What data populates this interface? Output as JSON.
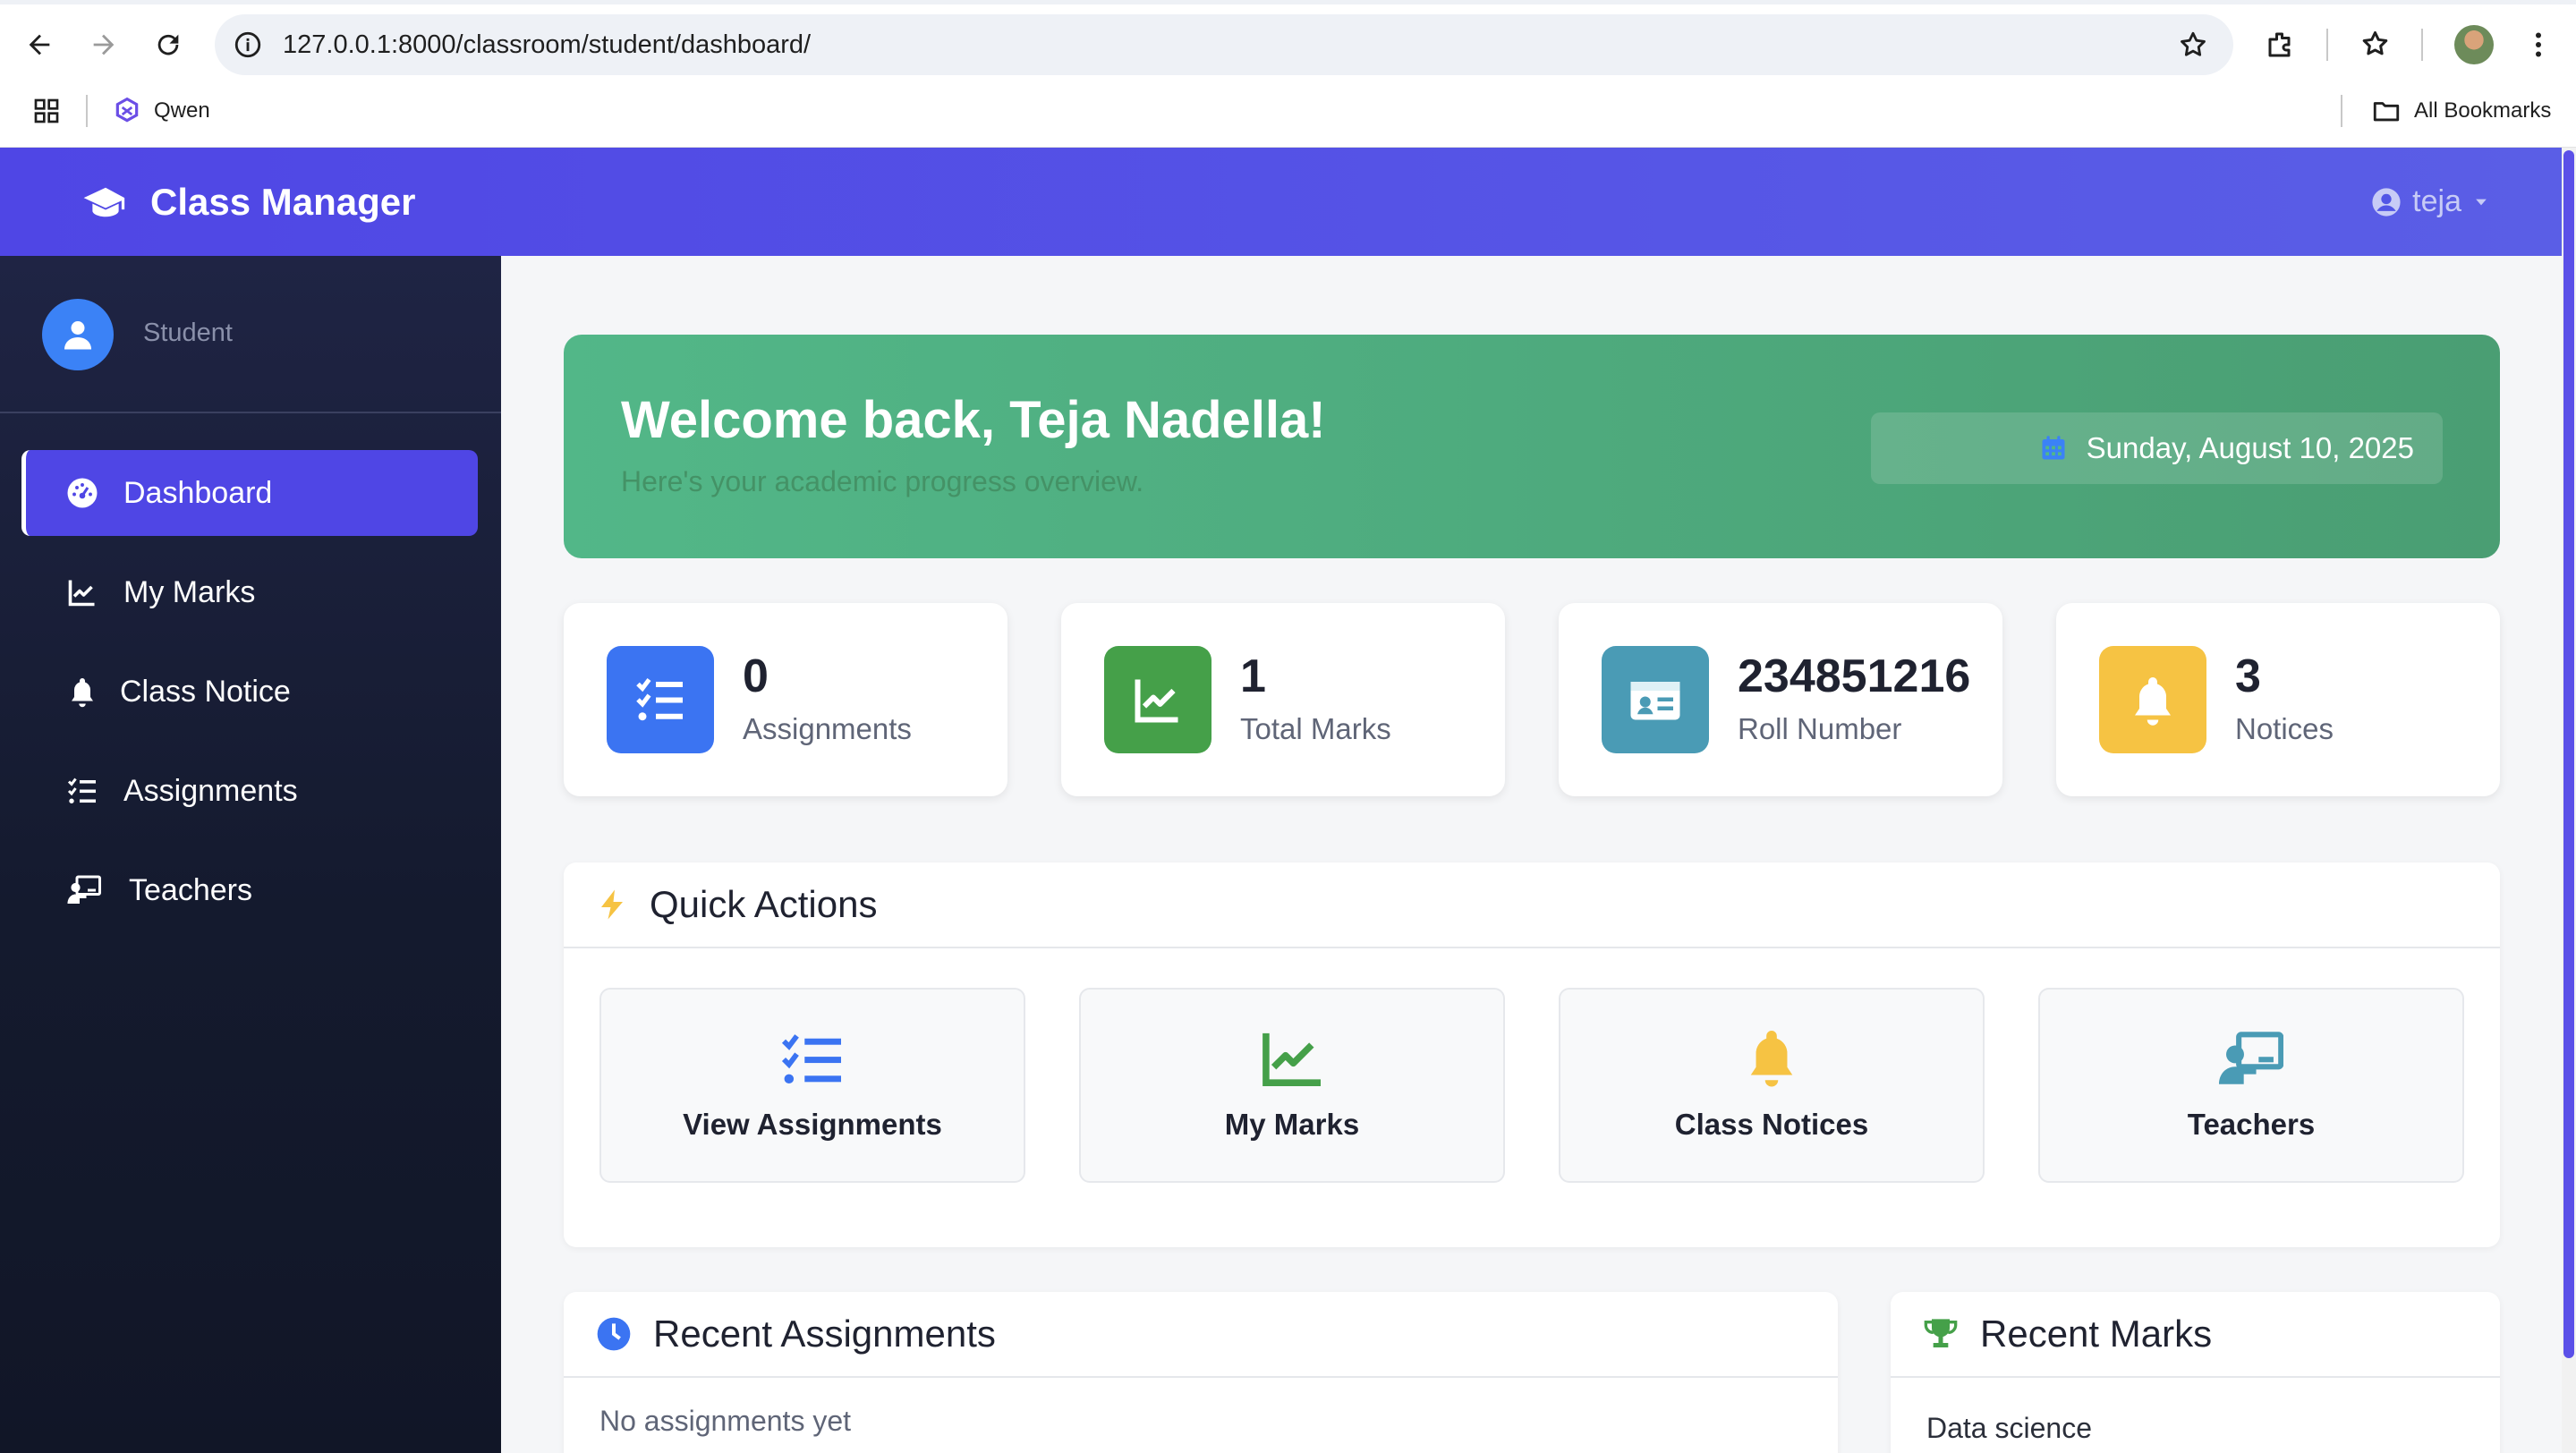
{
  "browser": {
    "url": "127.0.0.1:8000/classroom/student/dashboard/",
    "bookmark_qwen": "Qwen",
    "all_bookmarks": "All Bookmarks"
  },
  "header": {
    "brand": "Class Manager",
    "username": "teja"
  },
  "sidebar": {
    "role": "Student",
    "items": [
      {
        "label": "Dashboard",
        "icon": "dashboard-icon"
      },
      {
        "label": "My Marks",
        "icon": "chart-line-icon"
      },
      {
        "label": "Class Notice",
        "icon": "bell-icon"
      },
      {
        "label": "Assignments",
        "icon": "tasks-icon"
      },
      {
        "label": "Teachers",
        "icon": "chalkboard-teacher-icon"
      }
    ]
  },
  "welcome": {
    "title": "Welcome back, Teja Nadella!",
    "subtitle": "Here's your academic progress overview.",
    "date": "Sunday, August 10, 2025"
  },
  "stats": [
    {
      "value": "0",
      "label": "Assignments",
      "icon": "tasks-icon",
      "color": "#3b74f2"
    },
    {
      "value": "1",
      "label": "Total Marks",
      "icon": "chart-line-icon",
      "color": "#45a049"
    },
    {
      "value": "234851216",
      "label": "Roll Number",
      "icon": "id-card-icon",
      "color": "#4a9bb5"
    },
    {
      "value": "3",
      "label": "Notices",
      "icon": "bell-icon",
      "color": "#f6c343"
    }
  ],
  "quick_actions": {
    "title": "Quick Actions",
    "items": [
      {
        "label": "View Assignments",
        "icon": "tasks-icon",
        "color": "#3b74f2"
      },
      {
        "label": "My Marks",
        "icon": "chart-line-icon",
        "color": "#45a049"
      },
      {
        "label": "Class Notices",
        "icon": "bell-icon",
        "color": "#f6c343"
      },
      {
        "label": "Teachers",
        "icon": "chalkboard-teacher-icon",
        "color": "#4a9bb5"
      }
    ]
  },
  "recent_assignments": {
    "title": "Recent Assignments",
    "empty_text": "No assignments yet"
  },
  "recent_marks": {
    "title": "Recent Marks",
    "first_subject": "Data science"
  },
  "colors": {
    "primary": "#4f46e5",
    "sidebar": "#141a2e",
    "welcome": "#52b788"
  }
}
